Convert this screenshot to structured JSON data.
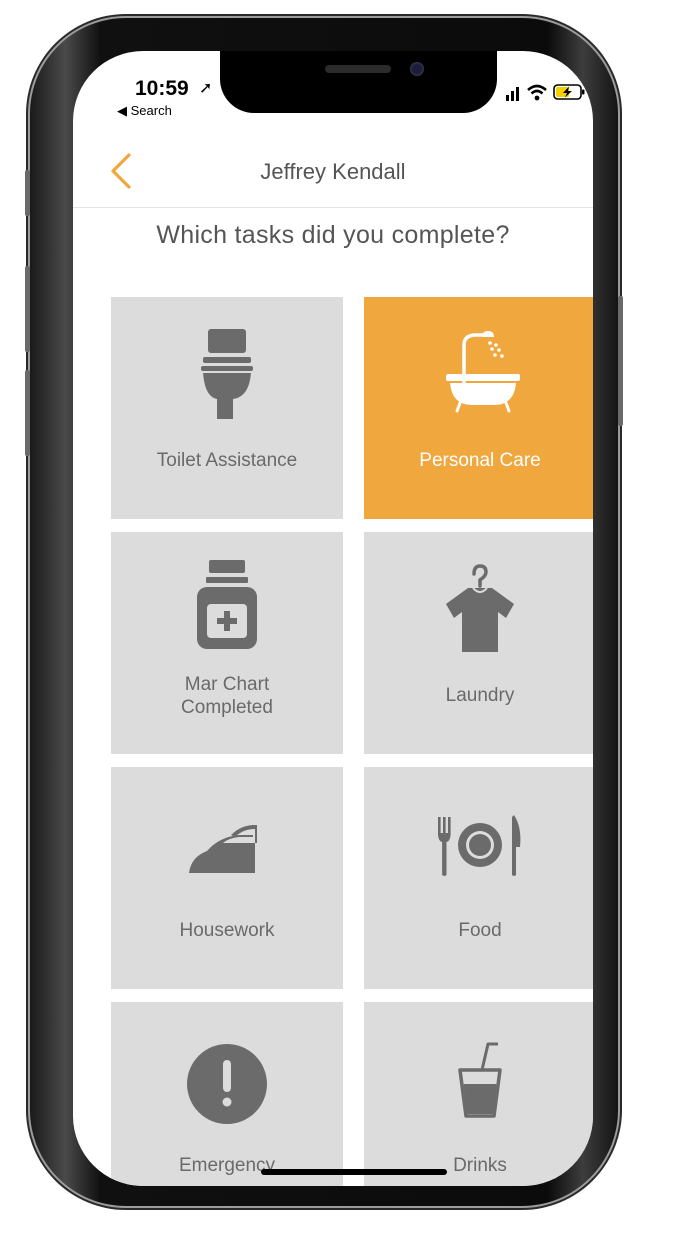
{
  "status": {
    "time": "10:59",
    "back_app": "◀ Search"
  },
  "header": {
    "title": "Jeffrey Kendall"
  },
  "question": "Which tasks did you complete?",
  "tasks": [
    {
      "label": "Toilet Assistance",
      "icon": "toilet-icon",
      "selected": false
    },
    {
      "label": "Personal Care",
      "icon": "bathtub-shower-icon",
      "selected": true
    },
    {
      "label": "Mar Chart\nCompleted",
      "icon": "medicine-jar-icon",
      "selected": false
    },
    {
      "label": "Laundry",
      "icon": "shirt-hanger-icon",
      "selected": false
    },
    {
      "label": "Housework",
      "icon": "iron-icon",
      "selected": false
    },
    {
      "label": "Food",
      "icon": "plate-cutlery-icon",
      "selected": false
    },
    {
      "label": "Emergency",
      "icon": "exclamation-icon",
      "selected": false
    },
    {
      "label": "Drinks",
      "icon": "drink-glass-icon",
      "selected": false
    }
  ],
  "colors": {
    "accent": "#f0a73d",
    "tile": "#dcdcdc",
    "icon": "#6b6b6b",
    "text": "#555555"
  }
}
